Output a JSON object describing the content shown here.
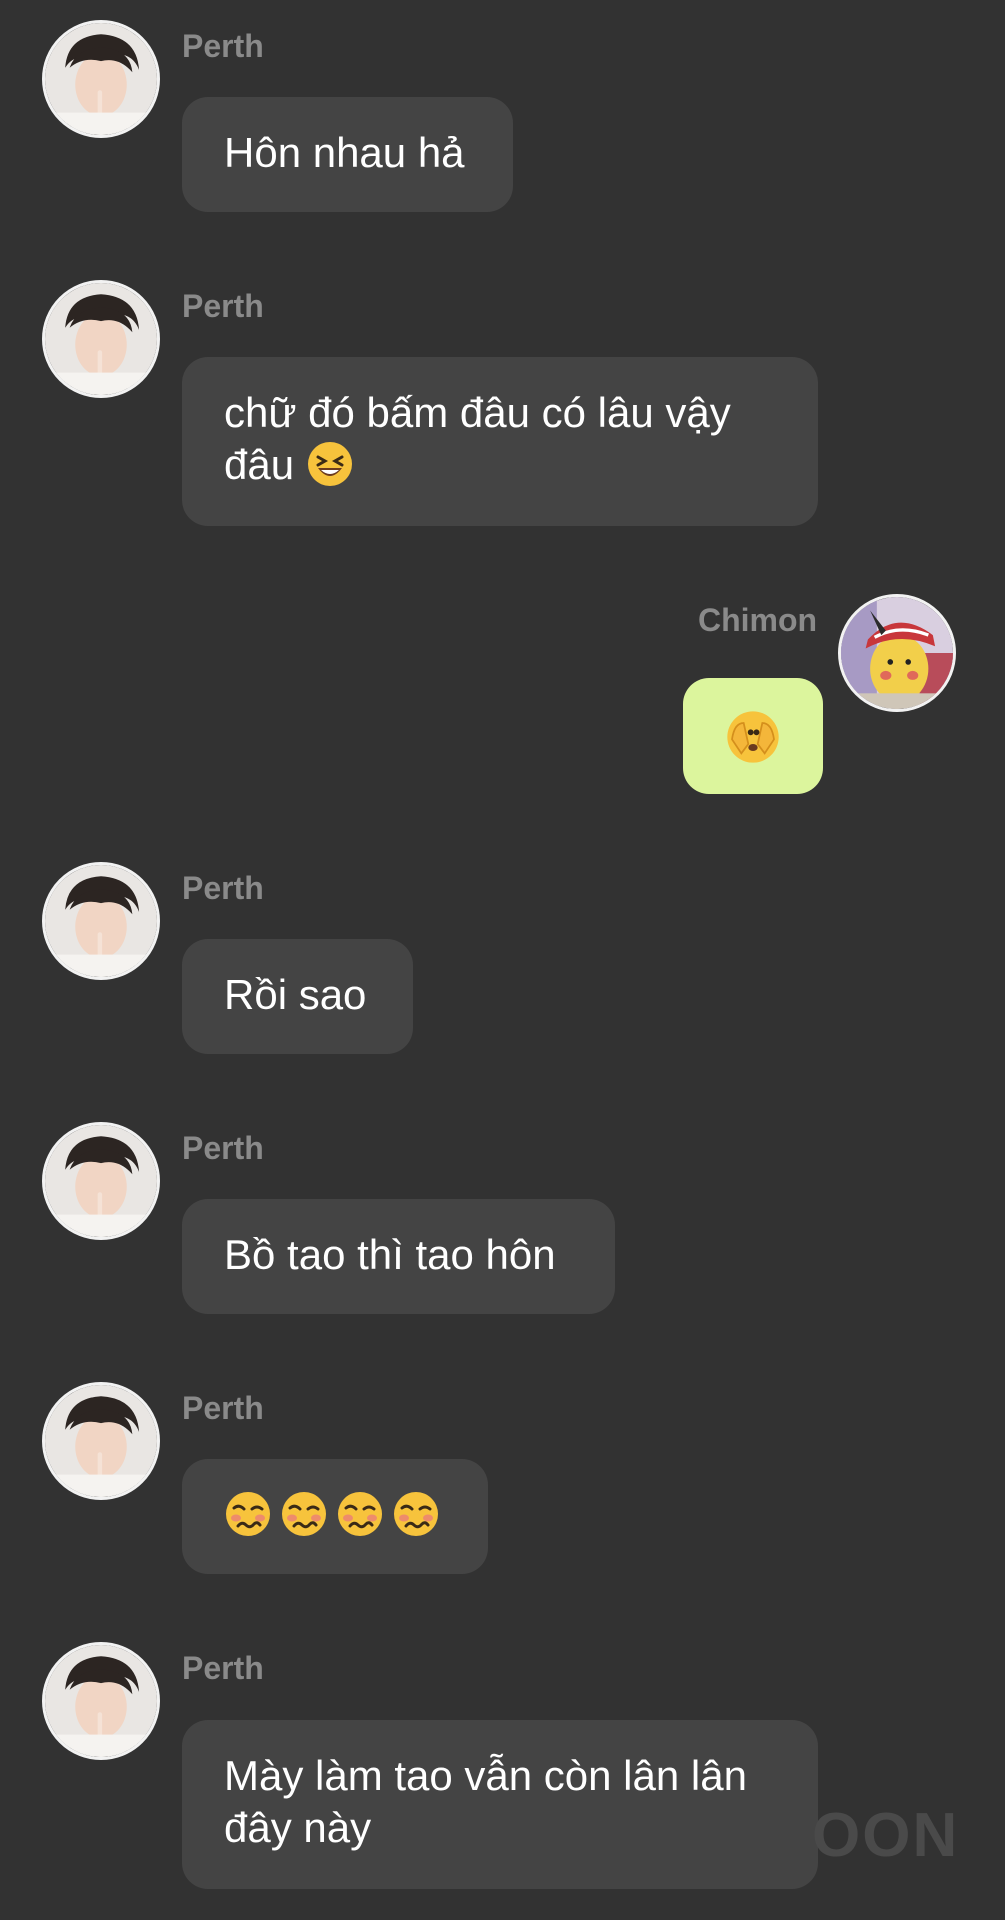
{
  "messages": [
    {
      "sender": "Perth",
      "text": "Hôn nhau hả"
    },
    {
      "sender": "Perth",
      "text": "chữ đó bấm đâu có lâu vậy",
      "text_line2": "đâu",
      "emoji": "laughing-emoji"
    },
    {
      "sender": "Chimon",
      "emoji": "face-with-open-eyes-and-hand-over-mouth-emoji"
    },
    {
      "sender": "Perth",
      "text": "Rồi sao"
    },
    {
      "sender": "Perth",
      "text": "Bồ tao thì tao hôn"
    },
    {
      "sender": "Perth",
      "emojis": [
        "woozy-face-emoji",
        "woozy-face-emoji",
        "woozy-face-emoji",
        "woozy-face-emoji"
      ]
    },
    {
      "sender": "Perth",
      "text": "Mày làm tao vẫn còn lân lân",
      "text_line2": "đây này"
    }
  ],
  "watermark": "OON",
  "colors": {
    "background": "#323232",
    "bubble_received": "#444444",
    "bubble_sent": "#dcf59d",
    "name_text": "#8a8a8a",
    "message_text": "#ffffff"
  }
}
